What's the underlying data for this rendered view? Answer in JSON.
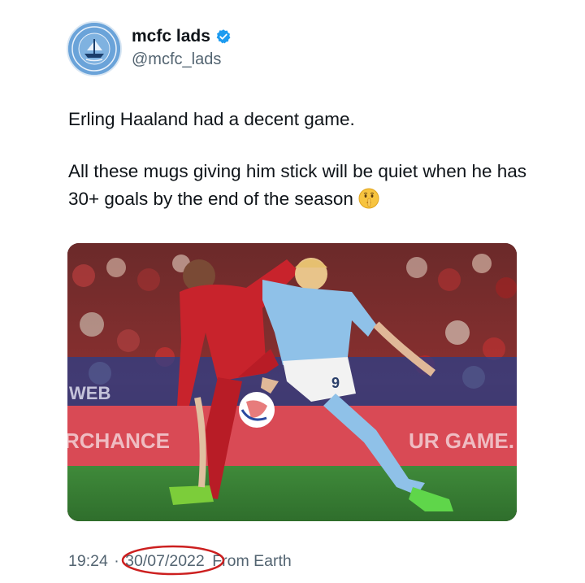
{
  "account": {
    "display_name": "mcfc lads",
    "handle": "@mcfc_lads",
    "avatar_icon": "ship-crest-icon",
    "verified_icon": "verified-badge-icon",
    "avatar_color": "#6aa3d9"
  },
  "tweet": {
    "line1": "Erling Haaland had a decent game.",
    "line2": "All these mugs giving him stick will be quiet when he has 30+ goals by the end of the season",
    "emoji_icon": "shushing-face-icon"
  },
  "media": {
    "description_icon": "football-match-photo",
    "banner_left": "RCHANCE",
    "banner_right": "UR GAME. C",
    "board_left": "WEB"
  },
  "meta": {
    "time": "19:24",
    "separator": "·",
    "date": "30/07/2022",
    "location": "From Earth",
    "annotation_color": "#cc1f1f"
  }
}
